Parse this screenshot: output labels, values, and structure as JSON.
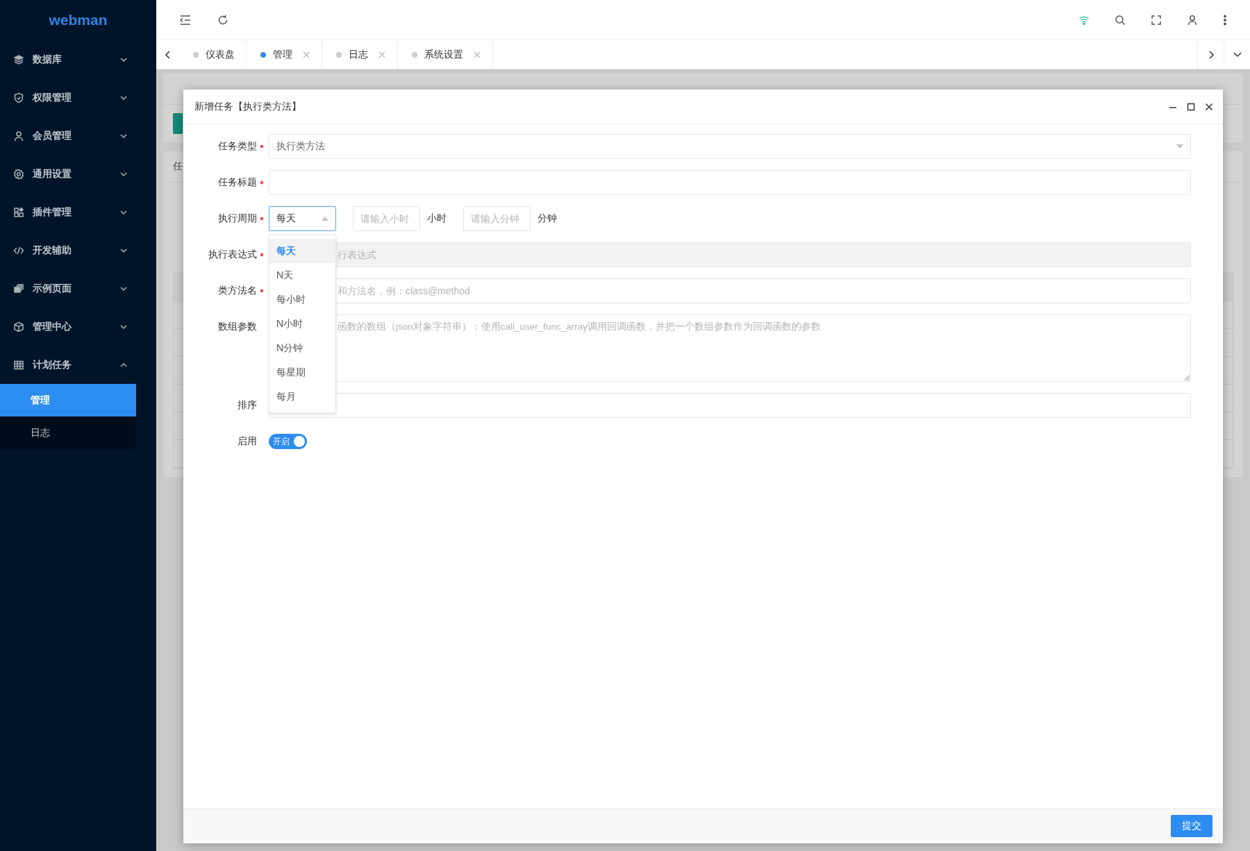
{
  "brand": "webman",
  "sidebar": {
    "items": [
      {
        "label": "数据库",
        "expanded": false
      },
      {
        "label": "权限管理",
        "expanded": false
      },
      {
        "label": "会员管理",
        "expanded": false
      },
      {
        "label": "通用设置",
        "expanded": false
      },
      {
        "label": "插件管理",
        "expanded": false
      },
      {
        "label": "开发辅助",
        "expanded": false
      },
      {
        "label": "示例页面",
        "expanded": false
      },
      {
        "label": "管理中心",
        "expanded": false
      },
      {
        "label": "计划任务",
        "expanded": true,
        "children": [
          {
            "label": "管理",
            "selected": true
          },
          {
            "label": "日志",
            "selected": false
          }
        ]
      }
    ]
  },
  "tabs": [
    {
      "label": "仪表盘",
      "selected": false,
      "closable": false
    },
    {
      "label": "管理",
      "selected": true,
      "closable": true
    },
    {
      "label": "日志",
      "selected": false,
      "closable": true
    },
    {
      "label": "系统设置",
      "selected": false,
      "closable": true
    }
  ],
  "background": {
    "cards": [
      {
        "kind": "form"
      },
      {
        "title": "任",
        "kind": "table"
      }
    ]
  },
  "dialog": {
    "title": "新增任务【执行类方法】",
    "fields": [
      {
        "kind": "select",
        "label": "任务类型",
        "required": true,
        "value": "执行类方法"
      },
      {
        "kind": "input",
        "label": "任务标题",
        "required": true
      },
      {
        "kind": "period",
        "label": "执行周期",
        "required": true,
        "value": "每天",
        "open": true,
        "options": [
          {
            "label": "每天",
            "selected": true
          },
          {
            "label": "N天",
            "selected": false
          },
          {
            "label": "每小时",
            "selected": false
          },
          {
            "label": "N小时",
            "selected": false
          },
          {
            "label": "N分钟",
            "selected": false
          },
          {
            "label": "每星期",
            "selected": false
          },
          {
            "label": "每月",
            "selected": false
          }
        ],
        "hour": {
          "placeholder": "请输入小时",
          "unit": "小时"
        },
        "minute": {
          "placeholder": "请输入分钟",
          "unit": "分钟"
        }
      },
      {
        "kind": "input",
        "label": "执行表达式",
        "required": true,
        "disabled": true,
        "placeholder": "行表达式"
      },
      {
        "kind": "input",
        "label": "类方法名",
        "required": true,
        "disabled": false,
        "placeholder": "和方法名，例：class@method"
      },
      {
        "kind": "textarea",
        "label": "数组参数",
        "required": false,
        "placeholder": "函数的数组（json对象字符串）；使用call_user_func_array调用回调函数，并把一个数组参数作为回调函数的参数"
      },
      {
        "kind": "input",
        "label": "排序",
        "required": false
      },
      {
        "kind": "switch",
        "label": "启用",
        "on": true,
        "text": "开启"
      }
    ],
    "submit": "提交"
  }
}
